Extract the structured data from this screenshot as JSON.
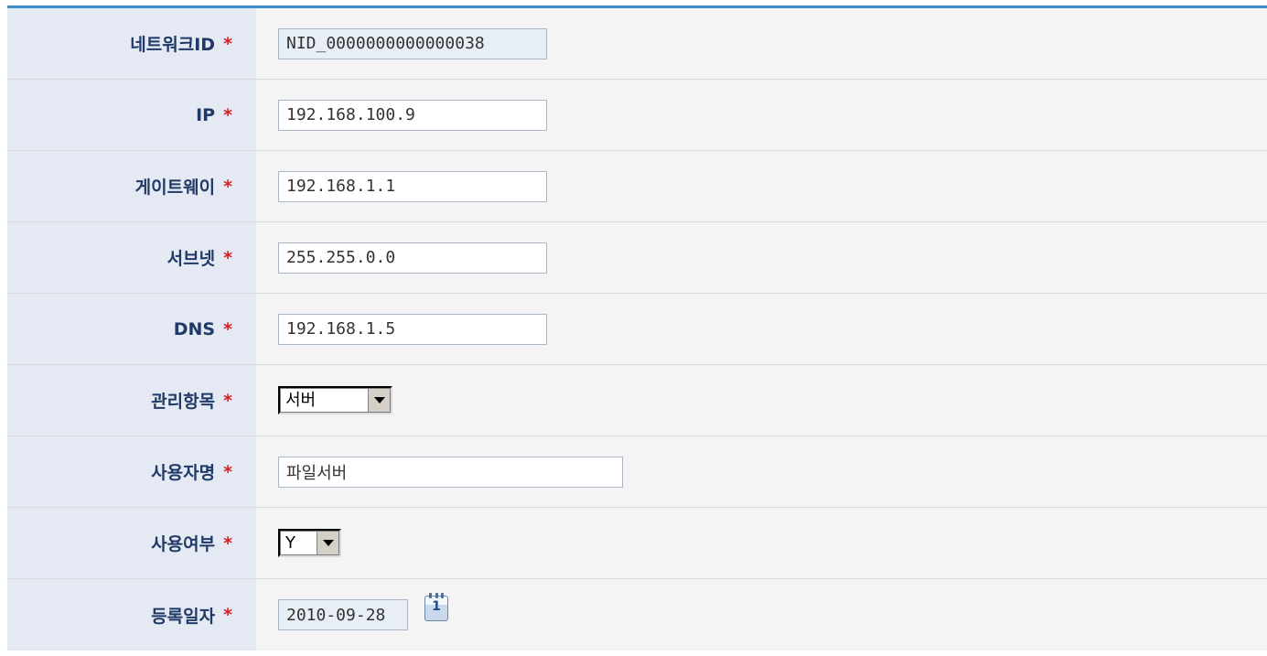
{
  "required_mark": "*",
  "fields": {
    "network_id": {
      "label": "네트워크ID",
      "value": "NID_0000000000000038"
    },
    "ip": {
      "label": "IP",
      "value": "192.168.100.9"
    },
    "gateway": {
      "label": "게이트웨이",
      "value": "192.168.1.1"
    },
    "subnet": {
      "label": "서브넷",
      "value": "255.255.0.0"
    },
    "dns": {
      "label": "DNS",
      "value": "192.168.1.5"
    },
    "category": {
      "label": "관리항목",
      "selected": "서버"
    },
    "user_name": {
      "label": "사용자명",
      "value": "파일서버"
    },
    "in_use": {
      "label": "사용여부",
      "selected": "Y"
    },
    "reg_date": {
      "label": "등록일자",
      "value": "2010-09-28"
    }
  },
  "calendar_icon": {
    "name": "calendar-icon",
    "glyph": "1"
  },
  "colors": {
    "accent": "#3d8fc9",
    "label_bg": "#e4e9f4",
    "label_text": "#1f3a66",
    "required": "#d81e1e"
  }
}
